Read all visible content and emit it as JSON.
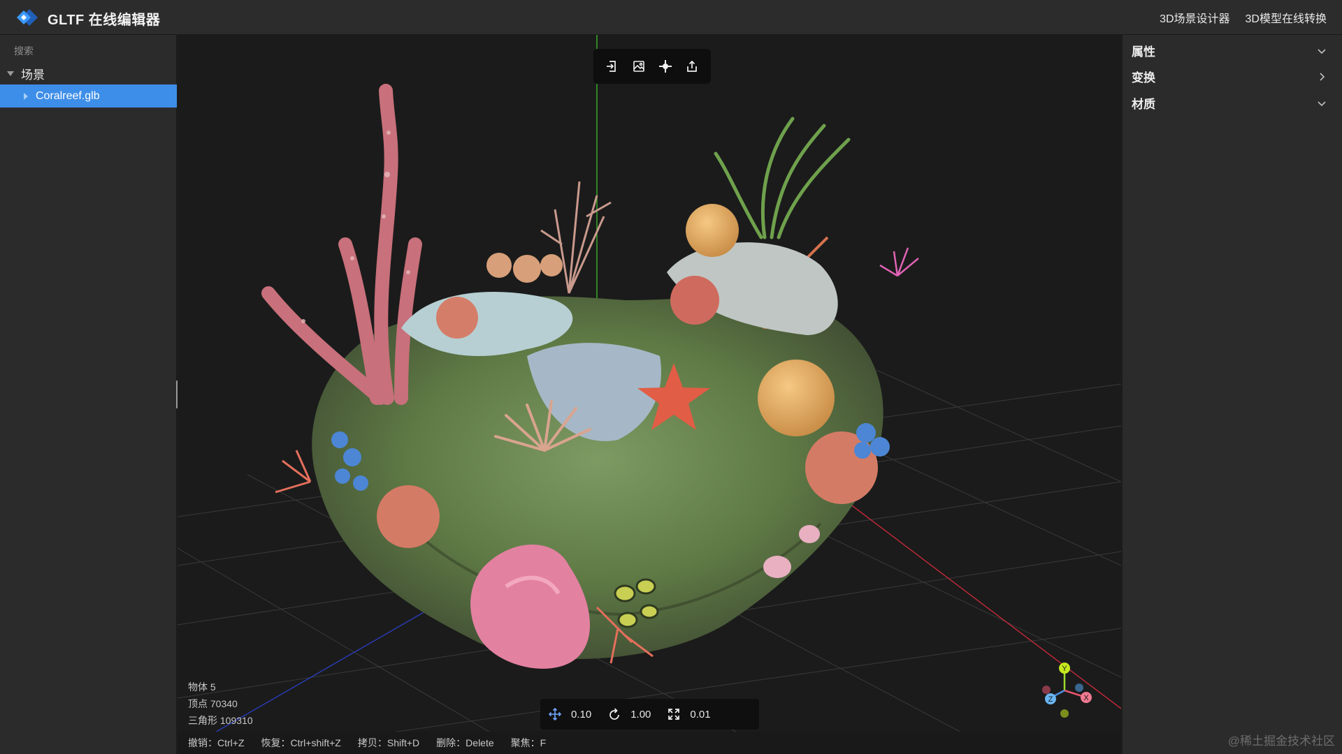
{
  "app": {
    "title": "GLTF 在线编辑器"
  },
  "header": {
    "links": [
      "3D场景设计器",
      "3D模型在线转换"
    ]
  },
  "sidebar": {
    "search_placeholder": "搜索",
    "tree": {
      "root_label": "场景",
      "child_label": "Coralreef.glb"
    }
  },
  "viewport": {
    "toolbar_icons": [
      "import-icon",
      "image-export-icon",
      "focus-icon",
      "share-export-icon"
    ],
    "stats": {
      "objects": "物体 5",
      "vertices": "顶点 70340",
      "triangles": "三角形 109310"
    },
    "snap": {
      "translate": "0.10",
      "rotate": "1.00",
      "scale": "0.01"
    },
    "shortcuts": [
      "撤销：Ctrl+Z",
      "恢复：Ctrl+shift+Z",
      "拷贝：Shift+D",
      "删除：Delete",
      "聚焦：F"
    ],
    "axes": {
      "x": "X",
      "y": "Y",
      "z": "Z"
    }
  },
  "properties_panel": {
    "sections": [
      {
        "label": "属性",
        "state": "expanded"
      },
      {
        "label": "变换",
        "state": "collapsed"
      },
      {
        "label": "材质",
        "state": "expanded"
      }
    ]
  },
  "colors": {
    "accent": "#3d8ee8",
    "axis_x": "#e2304a",
    "axis_y": "#7fd12c",
    "axis_z": "#2a4fd0"
  },
  "watermark": "@稀土掘金技术社区"
}
